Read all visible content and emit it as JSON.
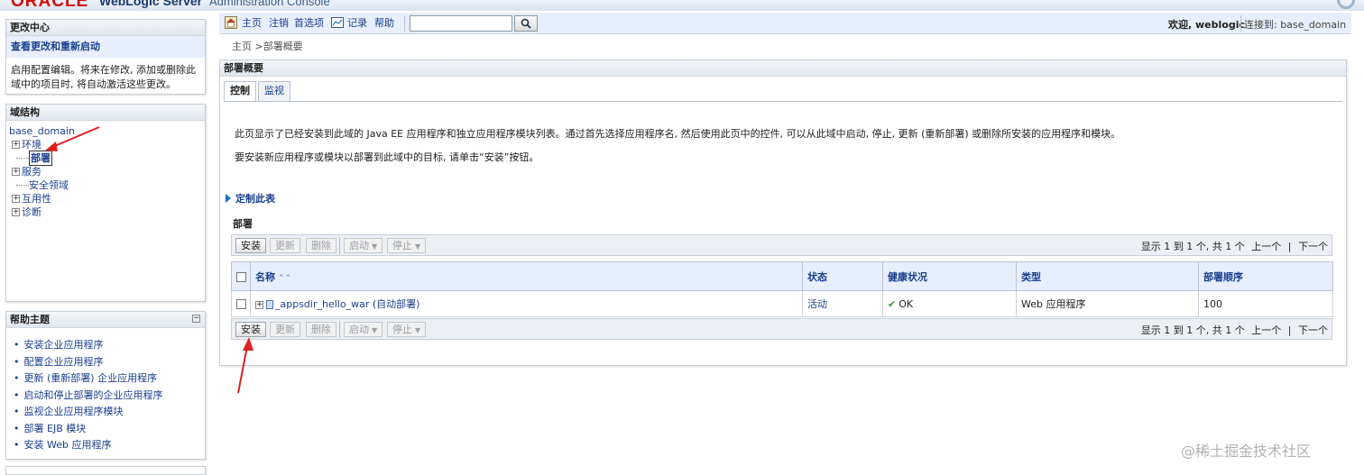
{
  "header": {
    "logo_text": "ORACLE",
    "product": "WebLogic Server",
    "console": "Administration Console"
  },
  "change_center": {
    "title": "更改中心",
    "link": "查看更改和重新启动",
    "desc_line1": "启用配置编辑。将来在修改, 添加或删除此",
    "desc_line2": "域中的项目时, 将自动激活这些更改。"
  },
  "domain_structure": {
    "title": "域结构",
    "root": "base_domain",
    "items": [
      {
        "label": "环境",
        "expandable": true
      },
      {
        "label": "部署",
        "expandable": false,
        "selected": true
      },
      {
        "label": "服务",
        "expandable": true
      },
      {
        "label": "安全领域",
        "expandable": false
      },
      {
        "label": "互用性",
        "expandable": true
      },
      {
        "label": "诊断",
        "expandable": true
      }
    ]
  },
  "help_topics": {
    "title": "帮助主题",
    "items": [
      "安装企业应用程序",
      "配置企业应用程序",
      "更新 (重新部署) 企业应用程序",
      "启动和停止部署的企业应用程序",
      "监视企业应用程序模块",
      "部署 EJB 模块",
      "安装 Web 应用程序"
    ]
  },
  "toolbar": {
    "home": "主页",
    "logout": "注销",
    "preferences": "首选项",
    "record": "记录",
    "help": "帮助",
    "search_value": "",
    "welcome": "欢迎, weblogic",
    "connected": "连接到: base_domain"
  },
  "breadcrumb": {
    "home": "主页",
    "separator": " >",
    "current": "部署概要"
  },
  "main": {
    "title": "部署概要",
    "tabs": [
      "控制",
      "监视"
    ],
    "intro_1": "此页显示了已经安装到此域的 Java EE 应用程序和独立应用程序模块列表。通过首先选择应用程序名, 然后使用此页中的控件, 可以从此域中启动, 停止, 更新 (重新部署) 或删除所安装的应用程序和模块。",
    "intro_2": "要安装新应用程序或模块以部署到此域中的目标, 请单击“安装”按钮。",
    "customize": "定制此表",
    "section_heading": "部署",
    "buttons": {
      "install": "安装",
      "update": "更新",
      "delete": "删除",
      "start": "启动",
      "stop": "停止"
    },
    "pager": {
      "summary": "显示 1 到 1 个, 共 1 个",
      "prev": "上一个",
      "sep": "|",
      "next": "下一个"
    },
    "table": {
      "columns": [
        "名称",
        "状态",
        "健康状况",
        "类型",
        "部署顺序"
      ],
      "rows": [
        {
          "name": "_appsdir_hello_war (自动部署)",
          "state": "活动",
          "health": "OK",
          "type": "Web 应用程序",
          "order": "100"
        }
      ]
    }
  },
  "watermark": "@稀土掘金技术社区",
  "colors": {
    "link": "#1a3f8e",
    "annotation_arrow": "#e02020",
    "toolbar_bg": "#e7eefc"
  }
}
